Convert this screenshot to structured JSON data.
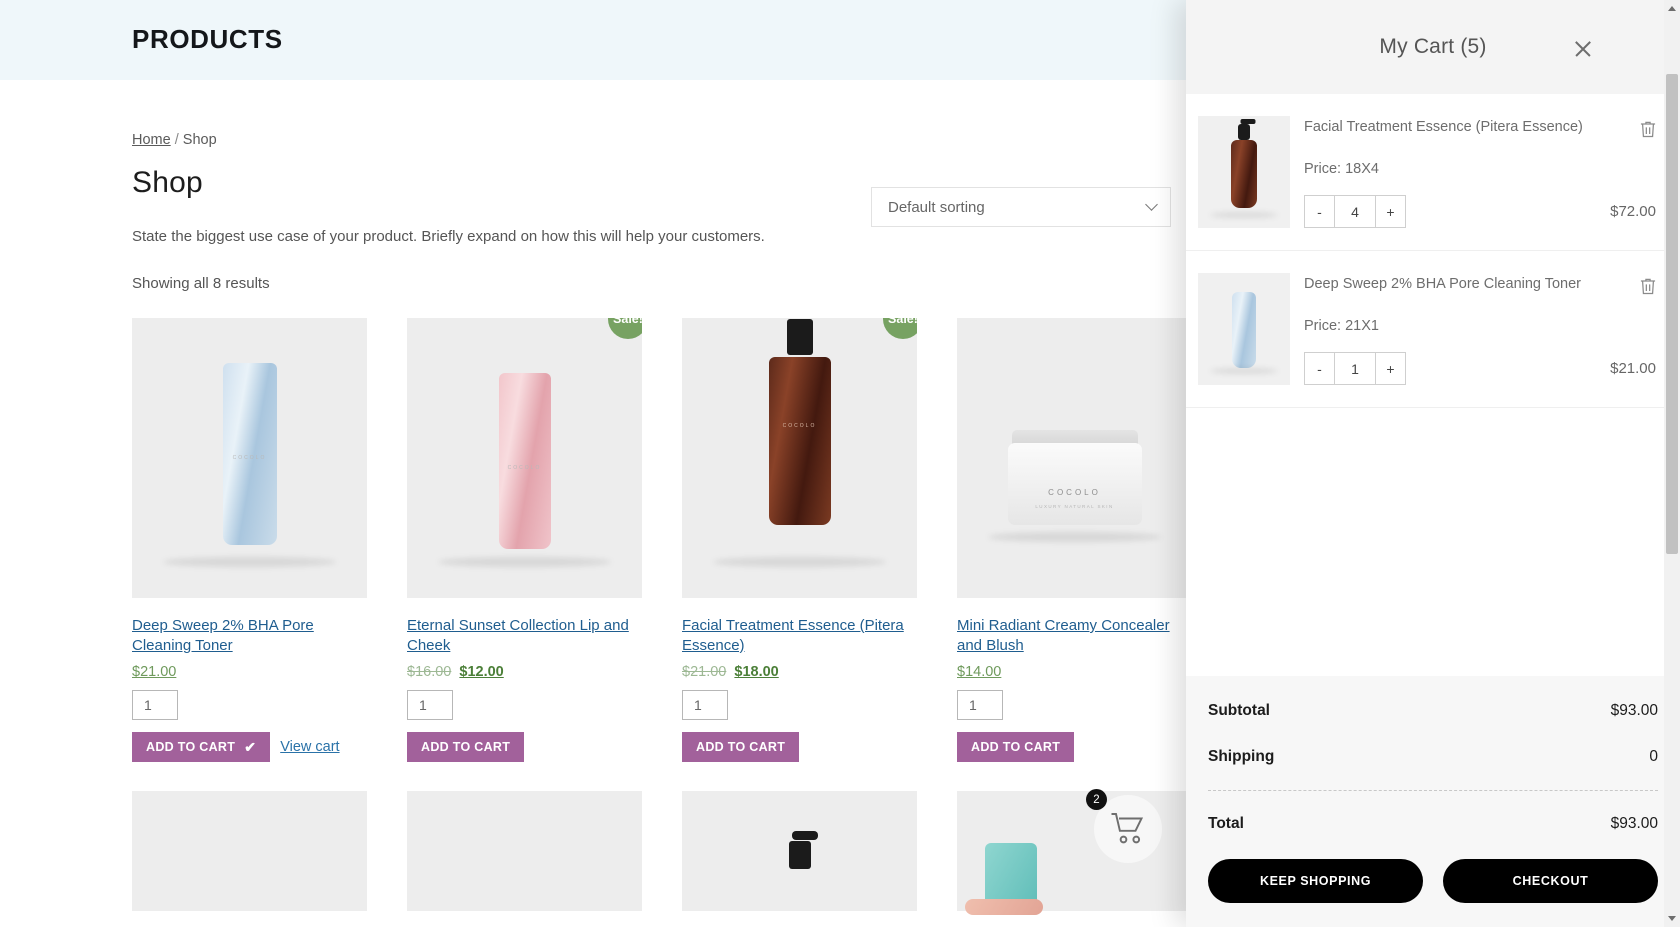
{
  "header": {
    "brand_title": "PRODUCTS"
  },
  "breadcrumb": {
    "home": "Home",
    "separator": "/",
    "current": "Shop"
  },
  "shop": {
    "title": "Shop",
    "intro": "State the biggest use case of your product. Briefly expand on how this will help your customers.",
    "result_count": "Showing all 8 results",
    "sorting_selected": "Default sorting"
  },
  "products": [
    {
      "name": "Deep Sweep 2% BHA Pore Cleaning Toner",
      "price_regular": "",
      "price_sale": "",
      "price_single": "$21.00",
      "on_sale": false,
      "qty": "1",
      "add_label": "ADD TO CART",
      "added": true,
      "view_cart_label": "View cart",
      "art": "bottle-blue"
    },
    {
      "name": "Eternal Sunset Collection Lip and Cheek",
      "price_regular": "$16.00",
      "price_sale": "$12.00",
      "price_single": "",
      "on_sale": true,
      "sale_badge": "Sale!",
      "qty": "1",
      "add_label": "ADD TO CART",
      "added": false,
      "view_cart_label": "",
      "art": "bottle-pink"
    },
    {
      "name": "Facial Treatment Essence (Pitera Essence)",
      "price_regular": "$21.00",
      "price_sale": "$18.00",
      "price_single": "",
      "on_sale": true,
      "sale_badge": "Sale!",
      "qty": "1",
      "add_label": "ADD TO CART",
      "added": false,
      "view_cart_label": "",
      "art": "pump-brown"
    },
    {
      "name": "Mini Radiant Creamy Concealer and Blush",
      "price_regular": "",
      "price_sale": "",
      "price_single": "$14.00",
      "on_sale": false,
      "qty": "1",
      "add_label": "ADD TO CART",
      "added": false,
      "view_cart_label": "",
      "art": "jar-white"
    }
  ],
  "floating_cart": {
    "count": "2",
    "icon": "shopping-cart-icon"
  },
  "cart": {
    "title": "My Cart (5)",
    "close_icon": "close-icon",
    "items": [
      {
        "title": "Facial Treatment Essence (Pitera Essence)",
        "price_label": "Price: 18X4",
        "qty": "4",
        "minus": "-",
        "plus": "+",
        "line_total": "$72.00",
        "remove_icon": "trash-icon",
        "art": "pump-brown"
      },
      {
        "title": "Deep Sweep 2% BHA Pore Cleaning Toner",
        "price_label": "Price: 21X1",
        "qty": "1",
        "minus": "-",
        "plus": "+",
        "line_total": "$21.00",
        "remove_icon": "trash-icon",
        "art": "bottle-blue"
      }
    ],
    "summary": {
      "subtotal_label": "Subtotal",
      "subtotal_value": "$93.00",
      "shipping_label": "Shipping",
      "shipping_value": "0",
      "total_label": "Total",
      "total_value": "$93.00"
    },
    "keep_shopping_label": "KEEP SHOPPING",
    "checkout_label": "CHECKOUT"
  },
  "colors": {
    "hero_band": "#eff7fa",
    "add_to_cart": "#a2619b",
    "sale_badge": "#77a262",
    "link": "#1f5d8f",
    "price": "#5f8a4d",
    "cart_button": "#000000"
  }
}
